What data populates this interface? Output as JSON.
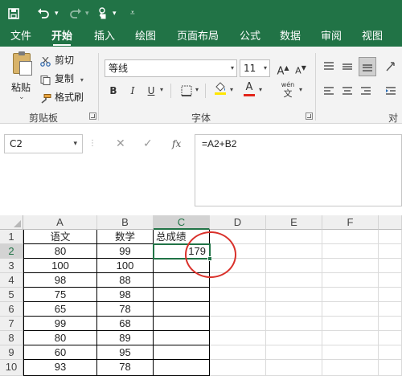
{
  "qat": {
    "save_icon": "save-icon",
    "undo_icon": "undo-icon",
    "redo_icon": "redo-icon",
    "touch_icon": "touch-mode-icon",
    "customize_icon": "customize-qat-icon"
  },
  "tabs": [
    "文件",
    "开始",
    "插入",
    "绘图",
    "页面布局",
    "公式",
    "数据",
    "审阅",
    "视图"
  ],
  "active_tab": "开始",
  "ribbon": {
    "clipboard": {
      "paste_label": "粘贴",
      "cut_label": "剪切",
      "copy_label": "复制",
      "format_painter_label": "格式刷",
      "group_label": "剪贴板"
    },
    "font": {
      "font_name": "等线",
      "font_size": "11",
      "grow_label": "A",
      "shrink_label": "A",
      "bold": "B",
      "italic": "I",
      "underline": "U",
      "font_color_label": "A",
      "phonetic_label": "wén",
      "group_label": "字体"
    },
    "align": {
      "group_label": "对齐"
    }
  },
  "formula_bar": {
    "name_box": "C2",
    "cancel_glyph": "✕",
    "enter_glyph": "✓",
    "fx_label": "fx",
    "formula": "=A2+B2"
  },
  "sheet": {
    "columns": [
      "A",
      "B",
      "C",
      "D",
      "E",
      "F"
    ],
    "selected_cell": "C2",
    "rows": [
      {
        "n": "1",
        "A": "语文",
        "B": "数学",
        "C": "总成绩"
      },
      {
        "n": "2",
        "A": "80",
        "B": "99",
        "C": "179"
      },
      {
        "n": "3",
        "A": "100",
        "B": "100",
        "C": ""
      },
      {
        "n": "4",
        "A": "98",
        "B": "88",
        "C": ""
      },
      {
        "n": "5",
        "A": "75",
        "B": "98",
        "C": ""
      },
      {
        "n": "6",
        "A": "65",
        "B": "78",
        "C": ""
      },
      {
        "n": "7",
        "A": "99",
        "B": "68",
        "C": ""
      },
      {
        "n": "8",
        "A": "80",
        "B": "89",
        "C": ""
      },
      {
        "n": "9",
        "A": "60",
        "B": "95",
        "C": ""
      },
      {
        "n": "10",
        "A": "93",
        "B": "78",
        "C": ""
      }
    ]
  },
  "colors": {
    "excel_green": "#217346",
    "annotation_red": "#d9302a"
  }
}
